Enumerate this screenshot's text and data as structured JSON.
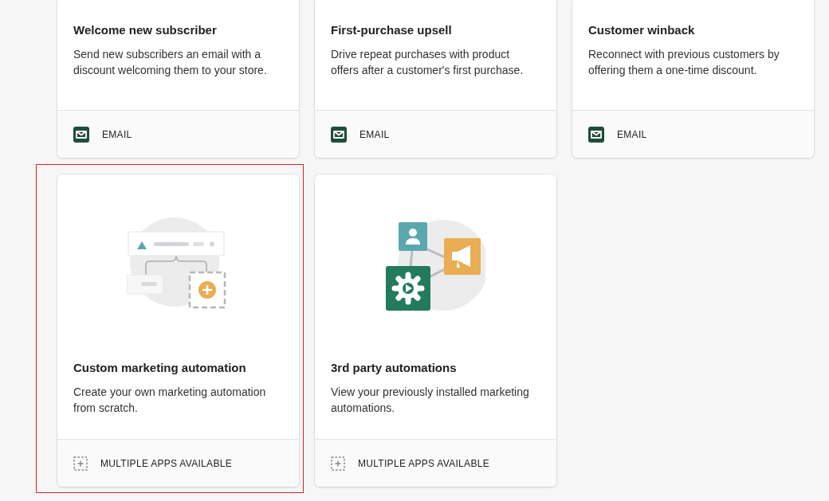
{
  "cards": [
    {
      "kind": "template",
      "title": "Welcome new subscriber",
      "description": "Send new subscribers an email with a discount welcoming them to your store.",
      "footer": {
        "kind": "email",
        "label": "EMAIL"
      },
      "highlighted": false
    },
    {
      "kind": "template",
      "title": "First-purchase upsell",
      "description": "Drive repeat purchases with product offers after a customer's first purchase.",
      "footer": {
        "kind": "email",
        "label": "EMAIL"
      },
      "highlighted": false
    },
    {
      "kind": "template",
      "title": "Customer winback",
      "description": "Reconnect with previous customers by offering them a one-time discount.",
      "footer": {
        "kind": "email",
        "label": "EMAIL"
      },
      "highlighted": false
    },
    {
      "kind": "custom",
      "title": "Custom marketing automation",
      "description": "Create your own marketing automation from scratch.",
      "footer": {
        "kind": "apps",
        "label": "MULTIPLE APPS AVAILABLE"
      },
      "highlighted": true
    },
    {
      "kind": "third_party",
      "title": "3rd party automations",
      "description": "View your previously installed marketing automations.",
      "footer": {
        "kind": "apps",
        "label": "MULTIPLE APPS AVAILABLE"
      },
      "highlighted": false
    }
  ]
}
